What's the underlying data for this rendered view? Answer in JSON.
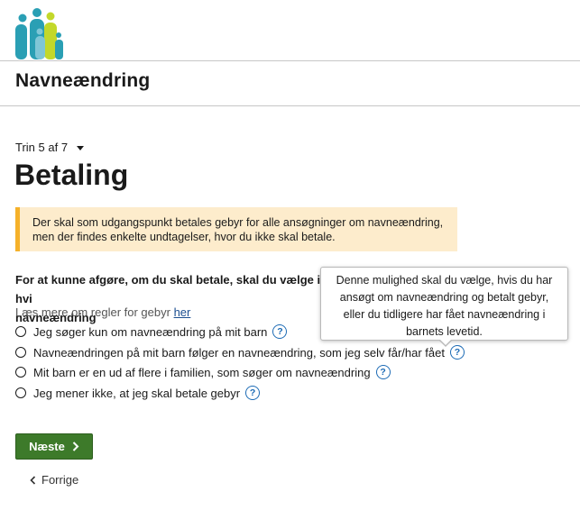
{
  "header": {
    "title": "Navneændring"
  },
  "step": {
    "label": "Trin 5 af 7"
  },
  "page": {
    "title": "Betaling"
  },
  "notice": {
    "text": "Der skal som udgangspunkt betales gebyr for alle ansøgninger om navneændring, men der findes enkelte undtagelser, hvor du ikke skal betale."
  },
  "question": {
    "line1": "For at kunne afgøre, om du skal betale, skal du vælge i hvi",
    "line2": "navneændring"
  },
  "readmore": {
    "text": "Læs mere om regler for gebyr",
    "link": "her"
  },
  "options": [
    {
      "label": "Jeg søger kun om navneændring på mit barn",
      "help": "?"
    },
    {
      "label": "Navneændringen på mit barn følger en navneændring, som jeg selv får/har fået",
      "help": "?"
    },
    {
      "label": "Mit barn er en ud af flere i familien, som søger om navneændring",
      "help": "?"
    },
    {
      "label": "Jeg mener ikke, at jeg skal betale gebyr",
      "help": "?"
    }
  ],
  "tooltip": {
    "text": "Denne mulighed skal du vælge, hvis du har ansøgt om navneændring og betalt gebyr, eller du tidligere har fået navneændring i barnets levetid."
  },
  "nav": {
    "next": "Næste",
    "back": "Forrige"
  },
  "colors": {
    "primary_button": "#3d7a2a",
    "notice_bg": "#fdeccc",
    "notice_border": "#f5b12a",
    "link": "#1d4f91",
    "help_icon": "#1d6bb5"
  }
}
